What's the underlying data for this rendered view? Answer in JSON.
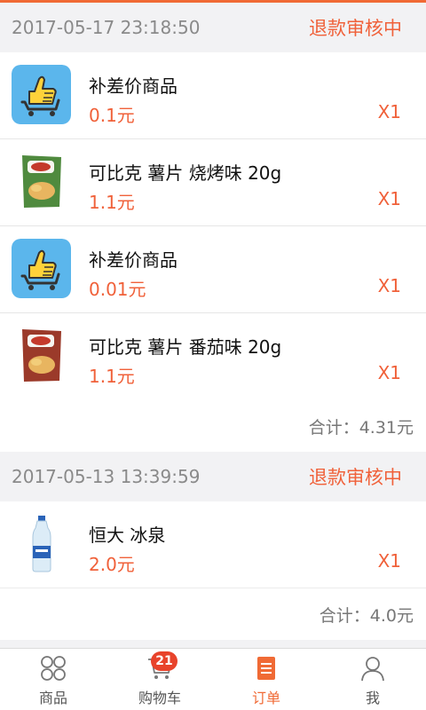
{
  "orders": [
    {
      "time": "2017-05-17 23:18:50",
      "status": "退款审核中",
      "items": [
        {
          "name": "补差价商品",
          "price": "0.1元",
          "qty": "X1",
          "icon": "thumbs-up-cart-icon"
        },
        {
          "name": "可比克 薯片 烧烤味 20g",
          "price": "1.1元",
          "qty": "X1",
          "icon": "chips-bag-green-image"
        },
        {
          "name": "补差价商品",
          "price": "0.01元",
          "qty": "X1",
          "icon": "thumbs-up-cart-icon"
        },
        {
          "name": "可比克 薯片 番茄味 20g",
          "price": "1.1元",
          "qty": "X1",
          "icon": "chips-bag-red-image"
        }
      ],
      "total": "合计：4.31元"
    },
    {
      "time": "2017-05-13 13:39:59",
      "status": "退款审核中",
      "items": [
        {
          "name": "恒大 冰泉",
          "price": "2.0元",
          "qty": "X1",
          "icon": "water-bottle-image"
        }
      ],
      "total": "合计：4.0元"
    }
  ],
  "tabbar": {
    "tabs": [
      {
        "label": "商品",
        "icon": "grid-circles-icon"
      },
      {
        "label": "购物车",
        "icon": "cart-icon",
        "badge": "21"
      },
      {
        "label": "订单",
        "icon": "order-doc-icon",
        "active": true
      },
      {
        "label": "我",
        "icon": "person-icon"
      }
    ]
  },
  "colors": {
    "accent": "#f06a35",
    "status": "#f0613a",
    "badge": "#e8432b",
    "background": "#f2f2f4"
  }
}
